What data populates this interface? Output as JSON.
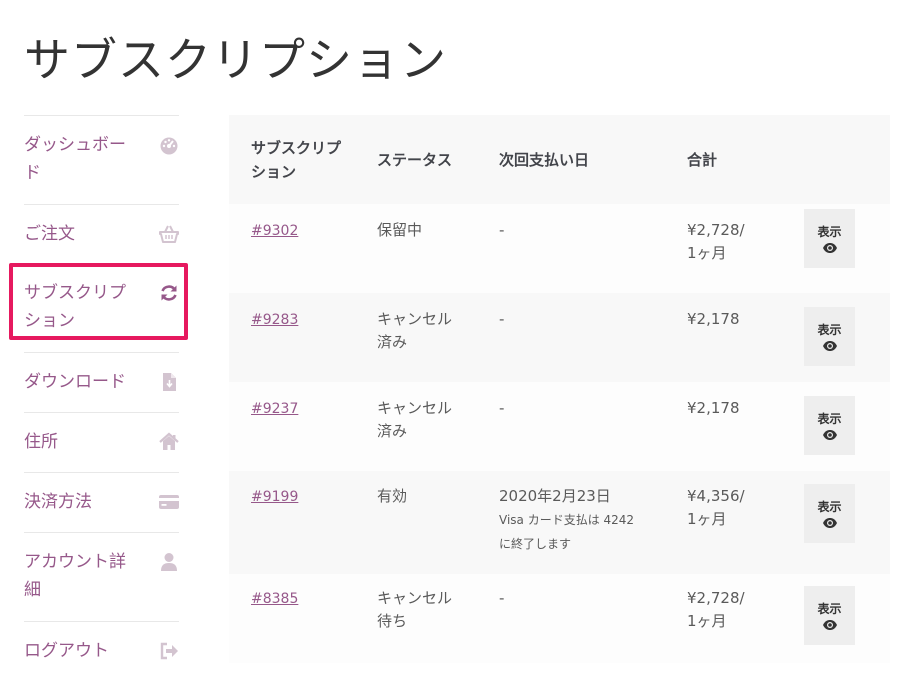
{
  "page": {
    "title": "サブスクリプション"
  },
  "nav": {
    "items": [
      {
        "label": "ダッシュボード",
        "icon": "dashboard-icon"
      },
      {
        "label": "ご注文",
        "icon": "basket-icon"
      },
      {
        "label": "サブスクリプション",
        "icon": "refresh-icon"
      },
      {
        "label": "ダウンロード",
        "icon": "file-icon"
      },
      {
        "label": "住所",
        "icon": "home-icon"
      },
      {
        "label": "決済方法",
        "icon": "credit-card-icon"
      },
      {
        "label": "アカウント詳細",
        "icon": "user-icon"
      },
      {
        "label": "ログアウト",
        "icon": "sign-out-icon"
      }
    ]
  },
  "table": {
    "headers": [
      "サブスクリプション",
      "ステータス",
      "次回支払い日",
      "合計"
    ],
    "rows": [
      {
        "id": "#9302",
        "status": "保留中",
        "next": "-",
        "note": "",
        "total": "¥2,728/1ヶ月",
        "action": "表示"
      },
      {
        "id": "#9283",
        "status": "キャンセル済み",
        "next": "-",
        "note": "",
        "total": "¥2,178",
        "action": "表示"
      },
      {
        "id": "#9237",
        "status": "キャンセル済み",
        "next": "-",
        "note": "",
        "total": "¥2,178",
        "action": "表示"
      },
      {
        "id": "#9199",
        "status": "有効",
        "next": "2020年2月23日",
        "note": "Visa カード支払は 4242 に終了します",
        "total": "¥4,356/1ヶ月",
        "action": "表示"
      },
      {
        "id": "#8385",
        "status": "キャンセル待ち",
        "next": "-",
        "note": "",
        "total": "¥2,728/1ヶ月",
        "action": "表示"
      }
    ]
  },
  "colors": {
    "accent": "#96588a",
    "highlight": "#e6195f",
    "icon": "#d3c4d0"
  }
}
